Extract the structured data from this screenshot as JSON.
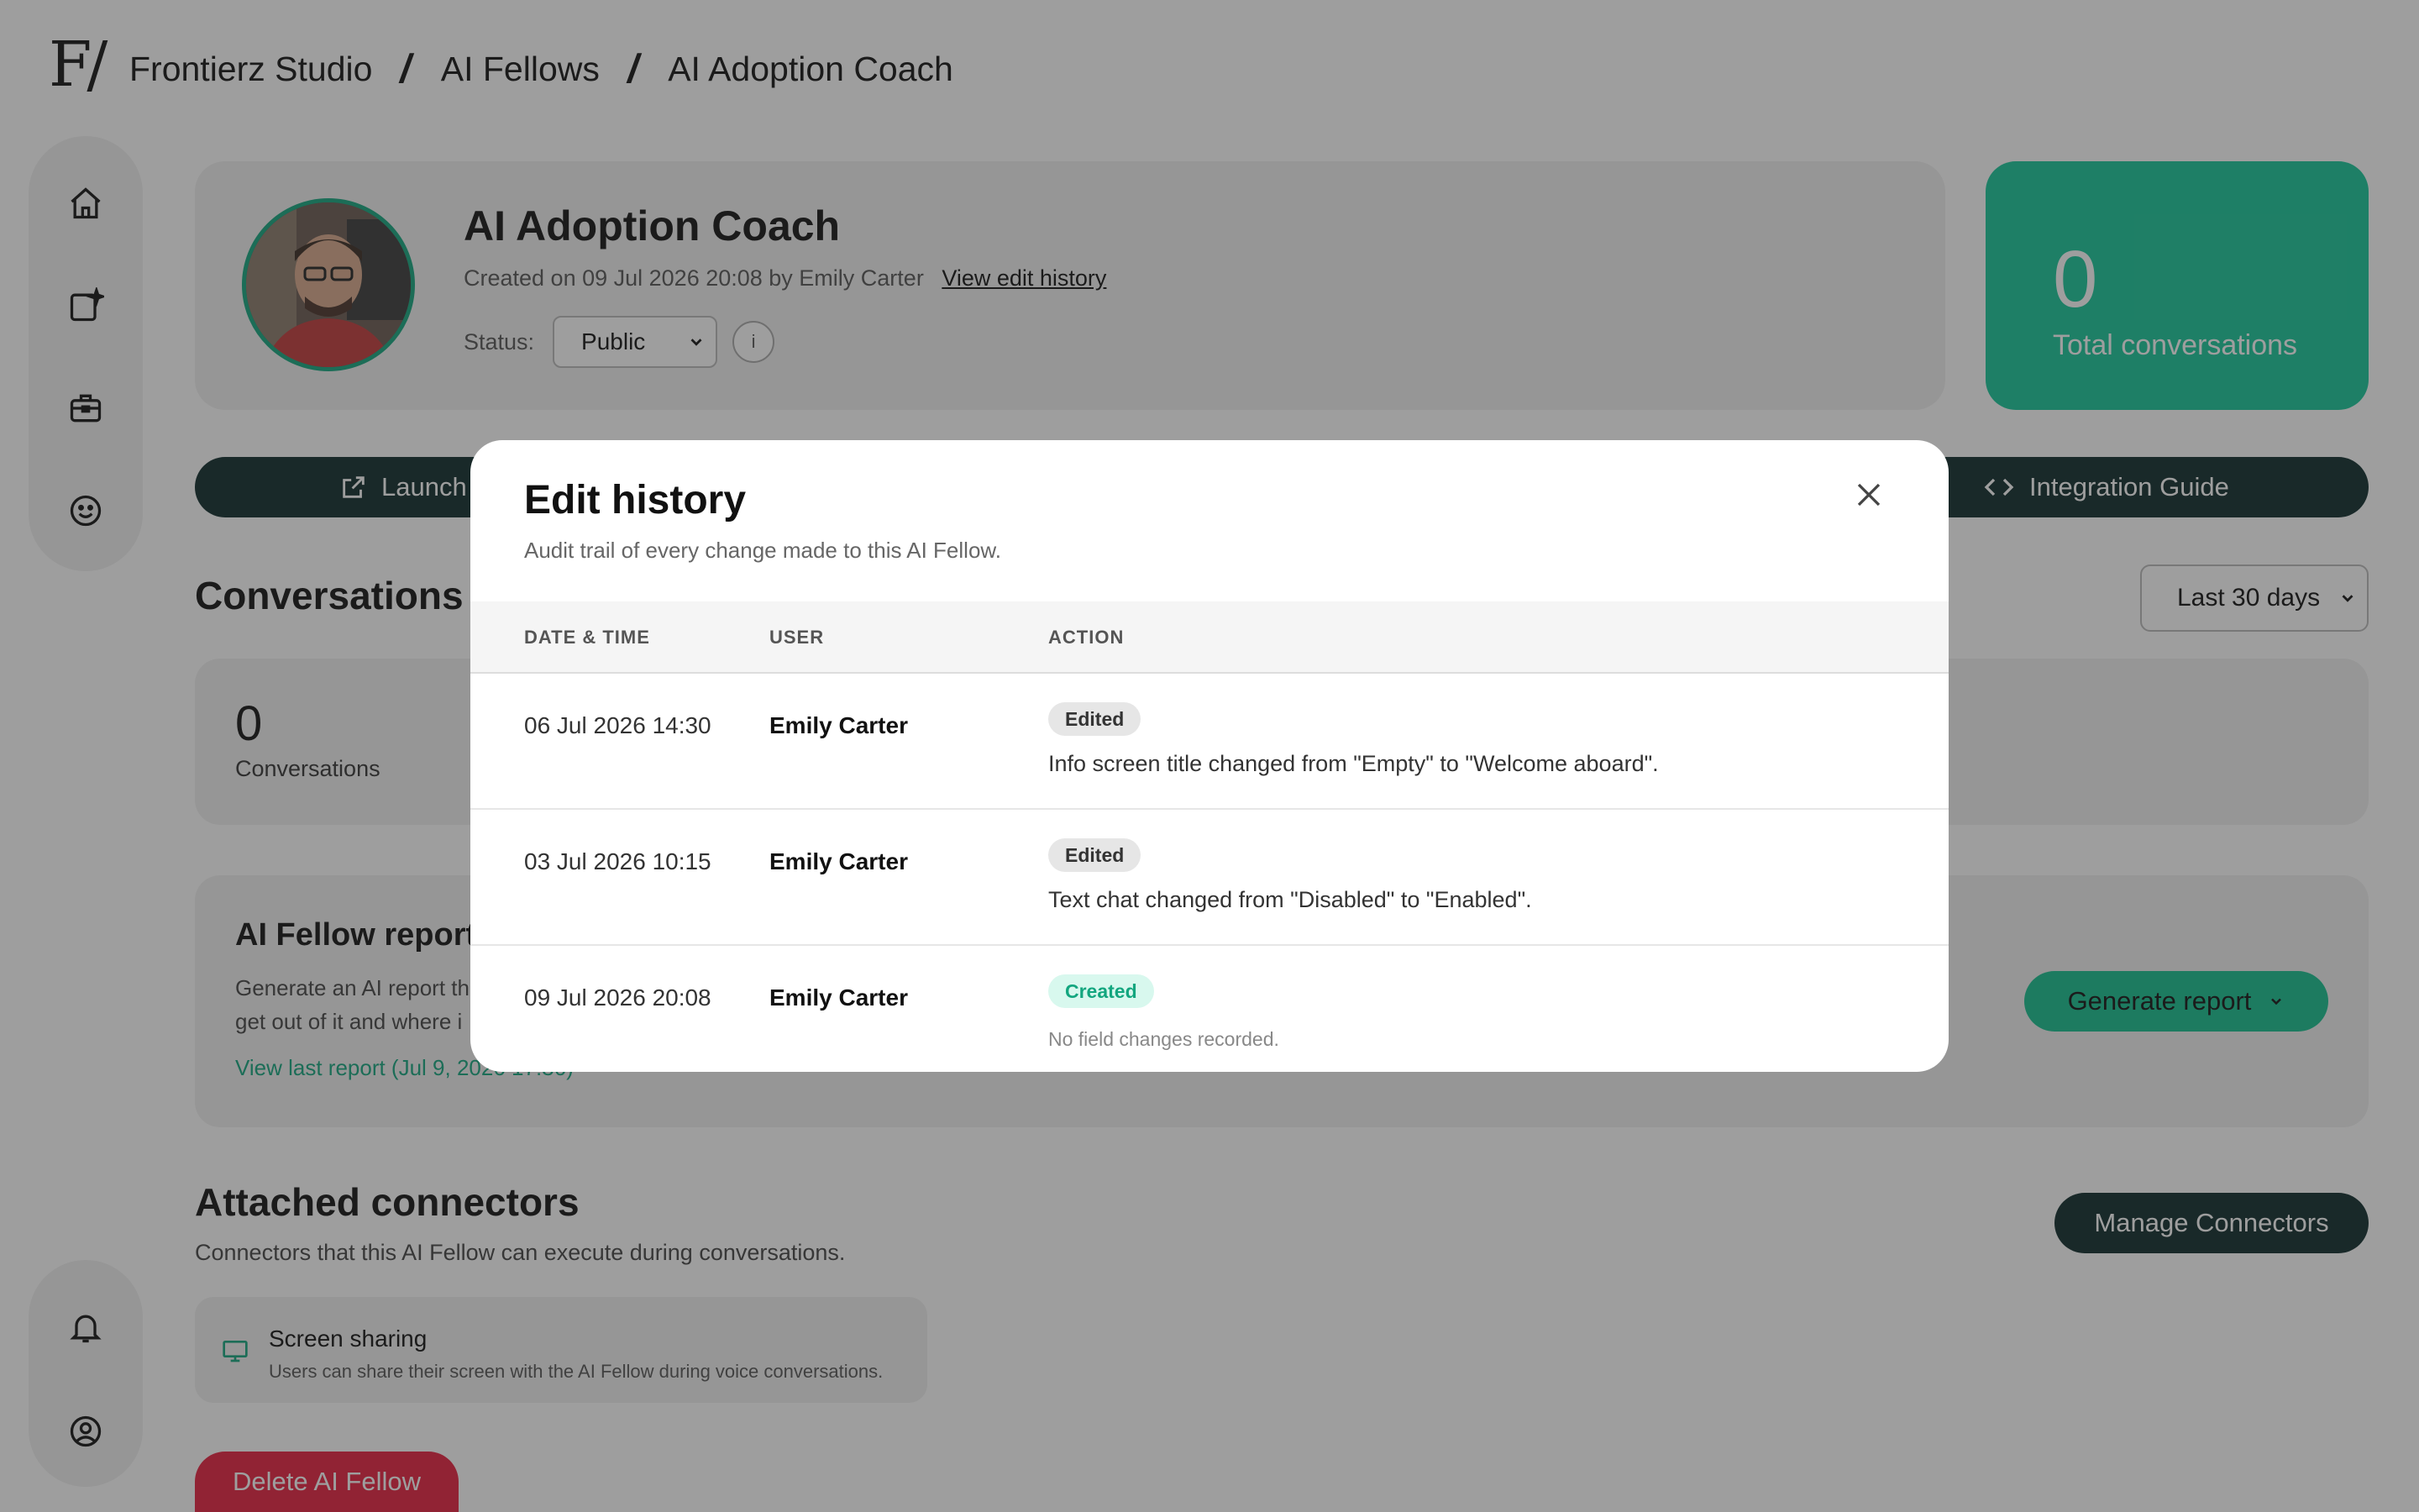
{
  "header": {
    "logo": "F/",
    "breadcrumb": [
      "Frontierz Studio",
      "AI Fellows",
      "AI Adoption Coach"
    ]
  },
  "profile": {
    "title": "AI Adoption Coach",
    "created_text": "Created on 09 Jul 2026 20:08 by Emily Carter",
    "edit_history_link": "View edit history",
    "status_label": "Status:",
    "status_value": "Public",
    "info_label": "i"
  },
  "stats": {
    "total_value": "0",
    "total_label": "Total conversations"
  },
  "actions": {
    "launch_label": "Launch",
    "integration_label": "Integration Guide"
  },
  "conversations": {
    "heading": "Conversations",
    "range": "Last 30 days",
    "count": "0",
    "count_label": "Conversations"
  },
  "report": {
    "title": "AI Fellow report",
    "desc": "Generate an AI report th get out of it and where i",
    "link": "View last report (Jul 9, 2026 17:36)",
    "generate_label": "Generate report"
  },
  "connectors": {
    "heading": "Attached connectors",
    "subtitle": "Connectors that this AI Fellow can execute during conversations.",
    "manage_label": "Manage Connectors",
    "items": [
      {
        "name": "Screen sharing",
        "desc": "Users can share their screen with the AI Fellow during voice conversations."
      }
    ]
  },
  "delete_label": "Delete AI Fellow",
  "modal": {
    "title": "Edit history",
    "subtitle": "Audit trail of every change made to this AI Fellow.",
    "columns": {
      "date": "DATE & TIME",
      "user": "USER",
      "action": "ACTION"
    },
    "rows": [
      {
        "date": "06 Jul 2026 14:30",
        "user": "Emily Carter",
        "badge": "Edited",
        "change": "Info screen title changed from \"Empty\" to \"Welcome aboard\"."
      },
      {
        "date": "03 Jul 2026 10:15",
        "user": "Emily Carter",
        "badge": "Edited",
        "change": "Text chat changed from \"Disabled\" to \"Enabled\"."
      },
      {
        "date": "09 Jul 2026 20:08",
        "user": "Emily Carter",
        "badge": "Created",
        "change": "No field changes recorded."
      }
    ]
  },
  "colors": {
    "accent": "#17c799",
    "dark": "#0e2b2b",
    "danger": "#e8203f"
  }
}
